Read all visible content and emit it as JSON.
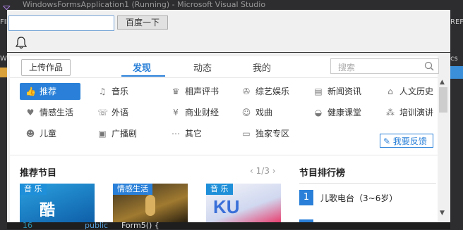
{
  "ide": {
    "title": "WindowsFormsApplication1 (Running) - Microsoft Visual Studio",
    "left_fragments": [
      "FIL",
      "Wi"
    ],
    "right_fragments": [
      "REF",
      "cs"
    ],
    "line_number": "16",
    "code_keyword": "public",
    "code_rest": "Form5() {"
  },
  "form": {
    "address_value": "",
    "go_button": "百度一下"
  },
  "web": {
    "upload_button": "上传作品",
    "tabs": [
      "发现",
      "动态",
      "我的"
    ],
    "search_placeholder": "搜索",
    "categories": [
      {
        "label": "推荐",
        "icon": "thumbs-up-icon"
      },
      {
        "label": "音乐",
        "icon": "music-note-icon"
      },
      {
        "label": "相声评书",
        "icon": "trophy-icon"
      },
      {
        "label": "综艺娱乐",
        "icon": "film-reel-icon"
      },
      {
        "label": "新闻资讯",
        "icon": "newspaper-icon"
      },
      {
        "label": "人文历史",
        "icon": "temple-icon"
      },
      {
        "label": "情感生活",
        "icon": "heart-icon"
      },
      {
        "label": "外语",
        "icon": "speech-bubble-icon"
      },
      {
        "label": "商业财经",
        "icon": "yen-monitor-icon"
      },
      {
        "label": "戏曲",
        "icon": "opera-mask-icon"
      },
      {
        "label": "健康课堂",
        "icon": "bowl-icon"
      },
      {
        "label": "培训演讲",
        "icon": "people-icon"
      },
      {
        "label": "儿童",
        "icon": "child-icon"
      },
      {
        "label": "广播剧",
        "icon": "clapperboard-icon"
      },
      {
        "label": "其它",
        "icon": "more-dots-icon"
      },
      {
        "label": "独家专区",
        "icon": "tv-icon"
      }
    ],
    "feedback_button": "我要反馈",
    "recommended_title": "推荐节目",
    "pager": "1/3",
    "thumbs": [
      {
        "tag": "音 乐",
        "color": "#1e8fd8"
      },
      {
        "tag": "情感生活",
        "color": "#2a80d8"
      },
      {
        "tag": "音 乐",
        "color": "#1e8fd8"
      }
    ],
    "ranking_title": "节目排行榜",
    "ranking": [
      {
        "rank": "1",
        "name": "儿歌电台（3~6岁）"
      }
    ]
  },
  "colors": {
    "accent": "#2a80d8",
    "ide_bg": "#2d2d30"
  }
}
